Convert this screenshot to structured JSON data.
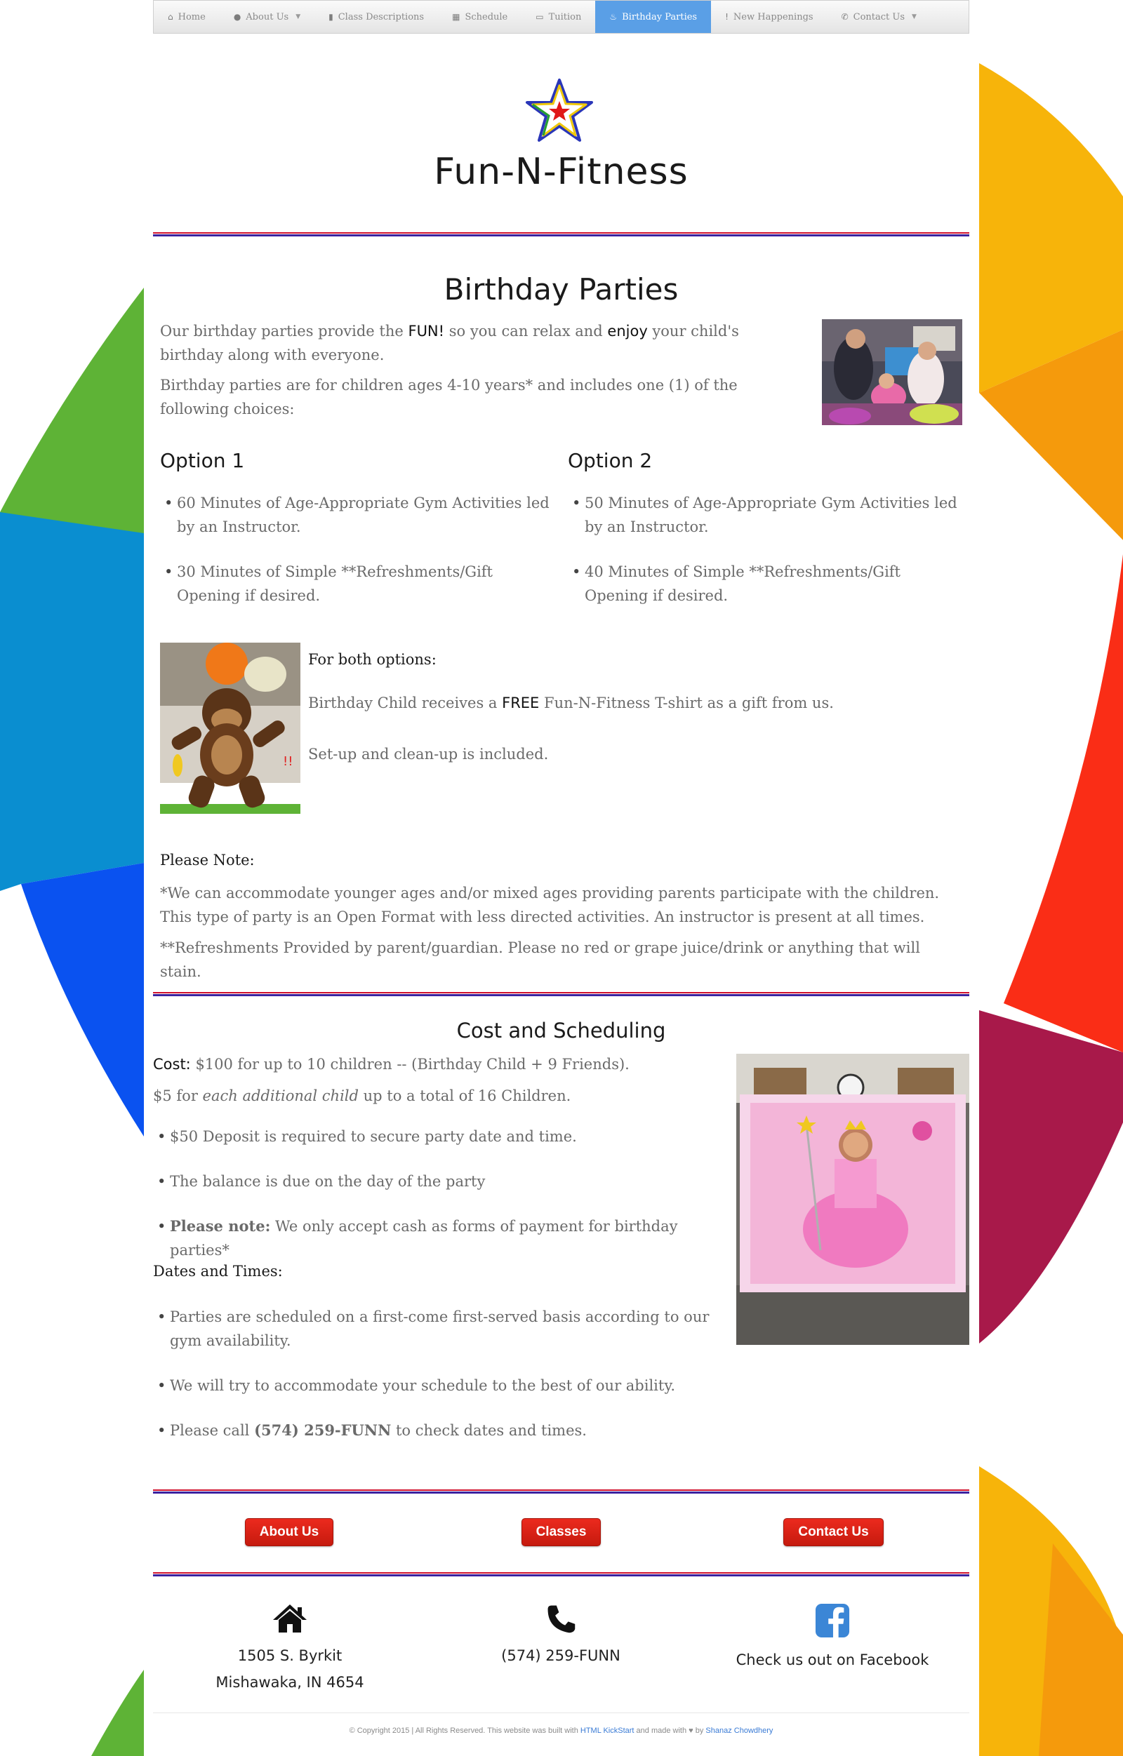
{
  "nav": {
    "items": [
      {
        "icon": "home-icon",
        "glyph": "⌂",
        "label": "Home",
        "caret": false,
        "active": false
      },
      {
        "icon": "info-icon",
        "glyph": "●",
        "label": "About Us",
        "caret": true,
        "active": false
      },
      {
        "icon": "book-icon",
        "glyph": "▮",
        "label": "Class Descriptions",
        "caret": false,
        "active": false
      },
      {
        "icon": "calendar-icon",
        "glyph": "▦",
        "label": "Schedule",
        "caret": false,
        "active": false
      },
      {
        "icon": "money-icon",
        "glyph": "▭",
        "label": "Tuition",
        "caret": false,
        "active": false
      },
      {
        "icon": "cake-icon",
        "glyph": "♨",
        "label": "Birthday Parties",
        "caret": false,
        "active": true
      },
      {
        "icon": "exclamation-icon",
        "glyph": "!",
        "label": "New Happenings",
        "caret": false,
        "active": false
      },
      {
        "icon": "phone-icon",
        "glyph": "✆",
        "label": "Contact Us",
        "caret": true,
        "active": false
      }
    ],
    "active_color": "#5a9fe6"
  },
  "header": {
    "site_title": "Fun-N-Fitness",
    "logo_icon": "star-logo-icon"
  },
  "birthday": {
    "title": "Birthday Parties",
    "intro": {
      "part1": "Our birthday parties provide the ",
      "fun": "FUN!",
      "part2": " so you can relax and ",
      "enjoy": "enjoy",
      "part3": " your child's birthday along with everyone."
    },
    "ages": "Birthday parties are for children ages 4-10 years* and includes one (1) of the following choices:",
    "option1": {
      "title": "Option 1",
      "items": [
        "60 Minutes of Age-Appropriate Gym Activities led by an Instructor.",
        "30 Minutes of Simple **Refreshments/Gift Opening if desired."
      ]
    },
    "option2": {
      "title": "Option 2",
      "items": [
        "50 Minutes of Age-Appropriate Gym Activities led by an Instructor.",
        "40 Minutes of Simple **Refreshments/Gift Opening if desired."
      ]
    },
    "both": {
      "title": "For both options:",
      "gift_part1": "Birthday Child receives a ",
      "gift_free": "FREE",
      "gift_part2": " Fun-N-Fitness T-shirt as a gift from us.",
      "setup": "Set-up and clean-up is included."
    },
    "note": {
      "title": "Please Note:",
      "line1": "*We can accommodate younger ages and/or mixed ages providing parents participate with the children. This type of party is an Open Format with less directed activities. An instructor is present at all times.",
      "line2": "**Refreshments Provided by parent/guardian. Please no red or grape juice/drink or anything that will stain."
    }
  },
  "cost": {
    "title": "Cost and Scheduling",
    "cost_label": "Cost:",
    "cost_text": " $100 for up to 10 children -- (Birthday Child + 9 Friends).",
    "extra_part1": "$5 for ",
    "extra_em": "each additional child",
    "extra_part2": " up to a total of 16 Children.",
    "items": [
      "$50 Deposit is required to secure party date and time.",
      "The balance is due on the day of the party"
    ],
    "payment_label": "Please note:",
    "payment_text": " We only accept cash as forms of payment for birthday parties*",
    "dates_title": "Dates and Times:",
    "dates_items": [
      "Parties are scheduled on a first-come first-served basis according to our gym availability.",
      "We will try to accommodate your schedule to the best of our ability."
    ],
    "call_part1": "Please call ",
    "call_phone": "(574) 259-FUNN",
    "call_part2": " to check dates and times."
  },
  "footer": {
    "buttons": {
      "about": "About Us",
      "classes": "Classes",
      "contact": "Contact Us"
    },
    "address_line1": "1505 S. Byrkit",
    "address_line2": "Mishawaka, IN 4654",
    "phone": "(574) 259-FUNN",
    "facebook": "Check us out on Facebook",
    "copyright_part1": "© Copyright 2015 | All Rights Reserved. This website was built with ",
    "kickstart": "HTML KickStart",
    "copyright_part2": " and made with ",
    "copyright_part3": " by ",
    "author": "Shanaz Chowdhery",
    "icons": {
      "home": "home-icon",
      "phone": "phone-icon",
      "facebook": "facebook-icon",
      "heart": "heart-icon"
    }
  },
  "colors": {
    "divider_red": "#d0102c",
    "divider_blue": "#3a22a0",
    "button_red": "#e0231a",
    "link_blue": "#3a7bd5"
  }
}
